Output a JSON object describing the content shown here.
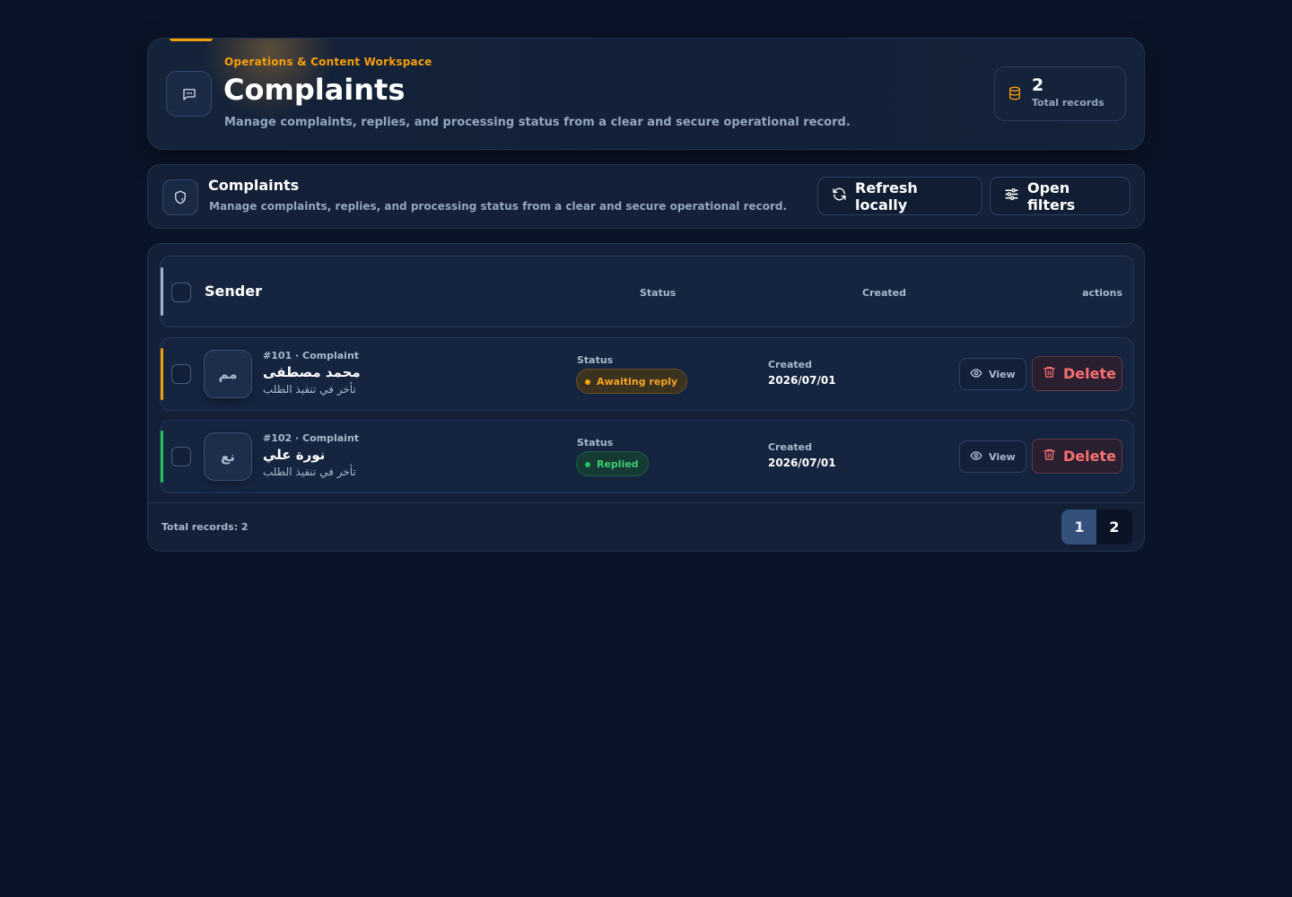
{
  "hero": {
    "kicker": "Operations & Content Workspace",
    "title": "Complaints",
    "subtitle": "Manage complaints, replies, and processing status from a clear and secure operational record.",
    "stat_value": "2",
    "stat_label": "Total records",
    "icon": "message-icon",
    "accent_color": "#f59e0b"
  },
  "toolbar": {
    "title": "Complaints",
    "subtitle": "Manage complaints, replies, and processing status from a clear and secure operational record.",
    "icon": "shield-icon",
    "refresh_label": "Refresh locally",
    "filters_label": "Open filters"
  },
  "table": {
    "headers": {
      "sender": "Sender",
      "status": "Status",
      "created": "Created",
      "actions": "actions"
    },
    "rows": [
      {
        "initials": "مم",
        "meta": "#101 · Complaint",
        "name": "محمد مصطفى",
        "subject": "تأخر في تنفيذ الطلب",
        "status_label": "Status",
        "status": "Awaiting reply",
        "status_color": "#f59e0b",
        "created_label": "Created",
        "created": "2026/07/01",
        "view_label": "View",
        "delete_label": "Delete"
      },
      {
        "initials": "نع",
        "meta": "#102 · Complaint",
        "name": "نورة علي",
        "subject": "تأخر في تنفيذ الطلب",
        "status_label": "Status",
        "status": "Replied",
        "status_color": "#22c55e",
        "created_label": "Created",
        "created": "2026/07/01",
        "view_label": "View",
        "delete_label": "Delete"
      }
    ]
  },
  "footer": {
    "total_text": "Total records: 2",
    "pages": [
      "1",
      "2"
    ],
    "current_page": "1"
  }
}
